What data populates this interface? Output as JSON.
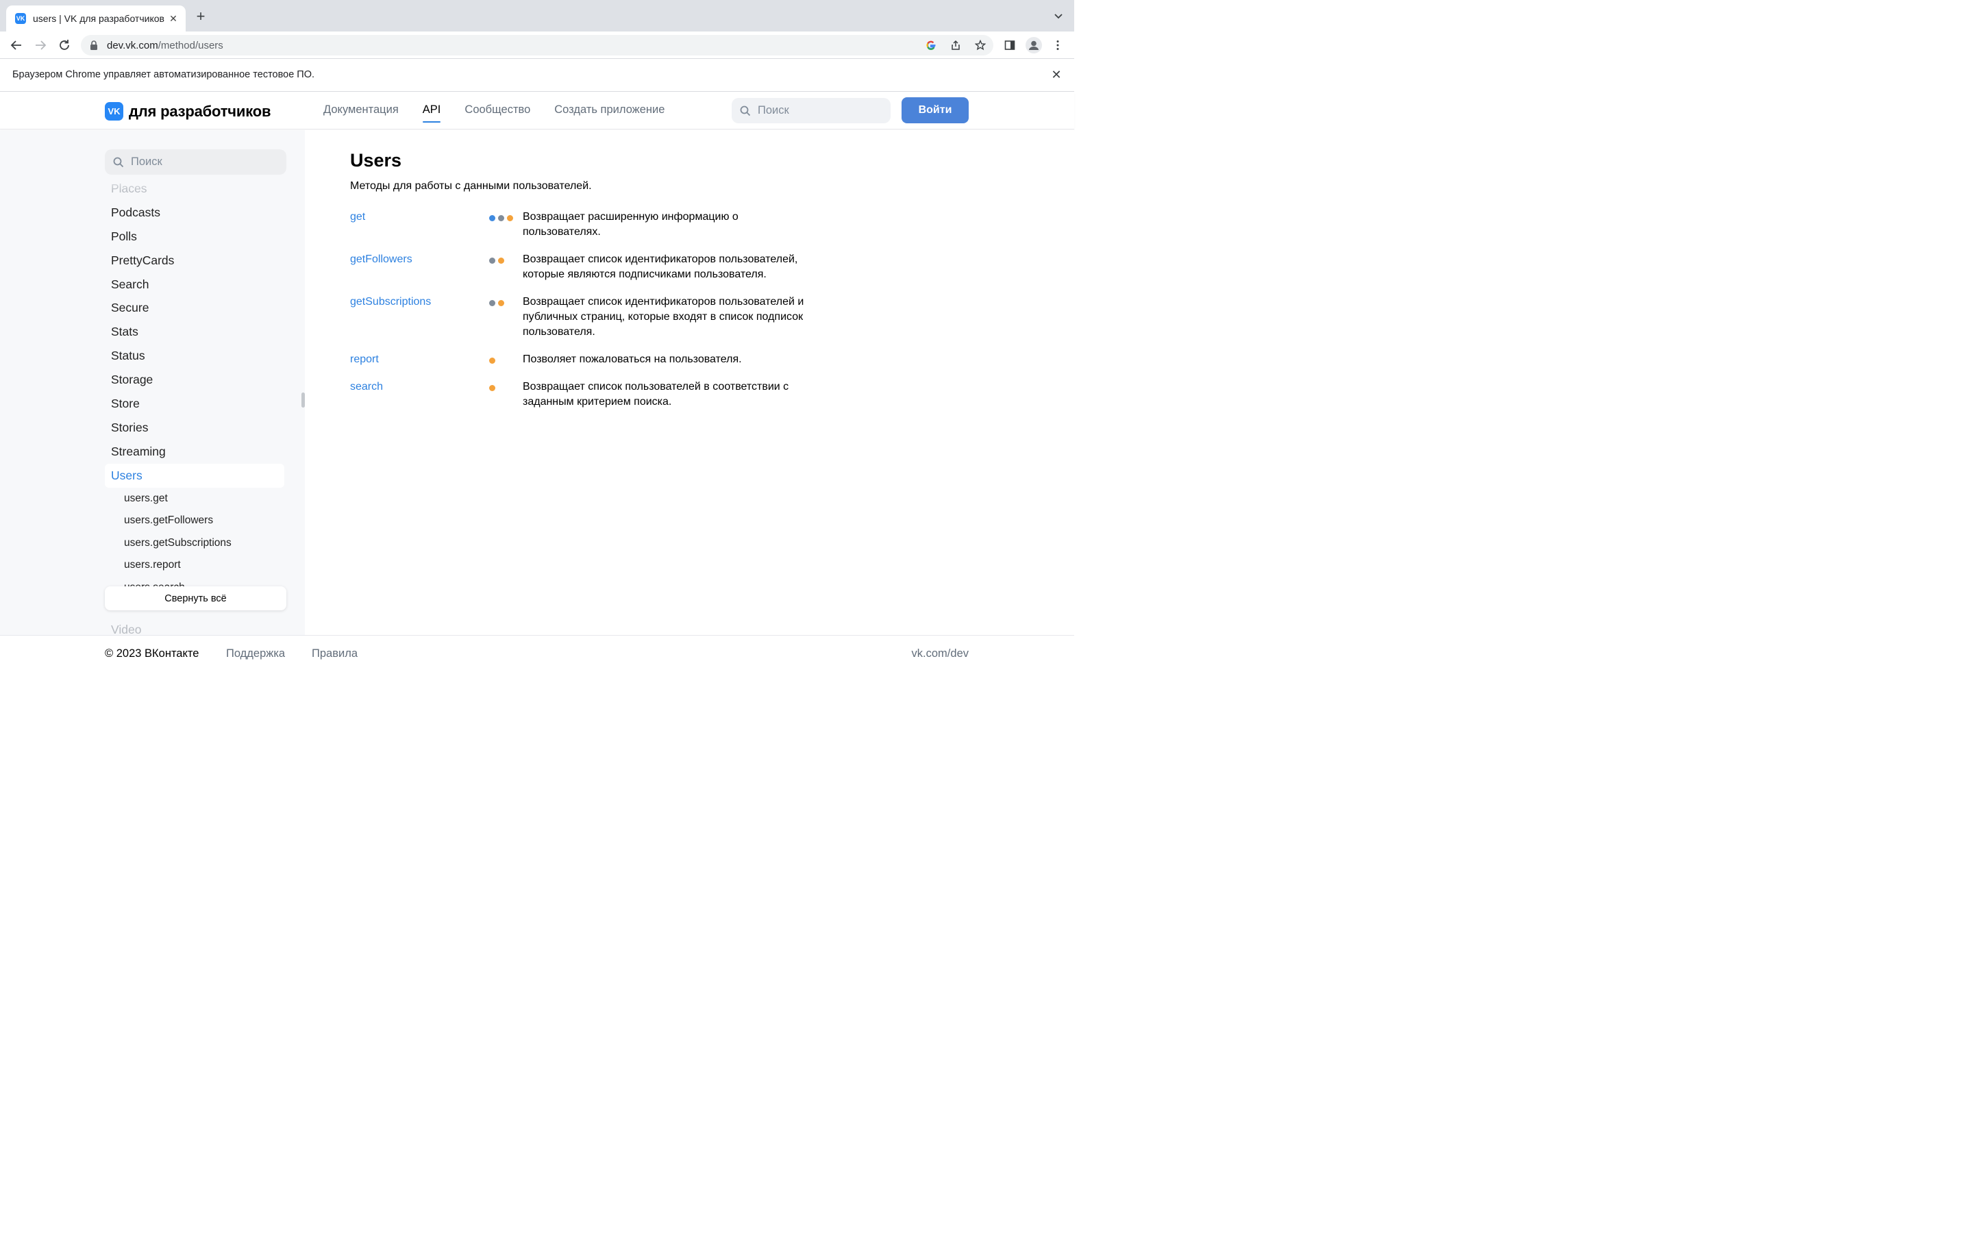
{
  "browser": {
    "tab_title": "users | VK для разработчиков",
    "favicon_text": "VK",
    "url_host": "dev.vk.com",
    "url_path": "/method/users",
    "infobar_text": "Браузером Chrome управляет автоматизированное тестовое ПО."
  },
  "header": {
    "logo_mark": "VK",
    "logo_text": "для разработчиков",
    "nav": [
      {
        "label": "Документация",
        "active": false
      },
      {
        "label": "API",
        "active": true
      },
      {
        "label": "Сообщество",
        "active": false
      },
      {
        "label": "Создать приложение",
        "active": false
      }
    ],
    "search_placeholder": "Поиск",
    "login_label": "Войти"
  },
  "sidebar": {
    "search_placeholder": "Поиск",
    "items": [
      "Places",
      "Podcasts",
      "Polls",
      "PrettyCards",
      "Search",
      "Secure",
      "Stats",
      "Status",
      "Storage",
      "Store",
      "Stories",
      "Streaming",
      "Users"
    ],
    "current": "Users",
    "sub_items": [
      "users.get",
      "users.getFollowers",
      "users.getSubscriptions",
      "users.report",
      "users.search"
    ],
    "collapse_label": "Свернуть всё",
    "bottom_item": "Video"
  },
  "main": {
    "title": "Users",
    "description": "Методы для работы с данными пользователей.",
    "methods": [
      {
        "name": "get",
        "dots": [
          "#3f8ae0",
          "#818c99",
          "#f4a23b"
        ],
        "description": "Возвращает расширенную информацию о пользователях."
      },
      {
        "name": "getFollowers",
        "dots": [
          "#818c99",
          "#f4a23b"
        ],
        "description": "Возвращает список идентификаторов пользователей, которые являются подписчиками пользователя."
      },
      {
        "name": "getSubscriptions",
        "dots": [
          "#818c99",
          "#f4a23b"
        ],
        "description": "Возвращает список идентификаторов пользователей и публичных страниц, которые входят в список подписок пользователя."
      },
      {
        "name": "report",
        "dots": [
          "#f4a23b"
        ],
        "description": "Позволяет пожаловаться на пользователя."
      },
      {
        "name": "search",
        "dots": [
          "#f4a23b"
        ],
        "description": "Возвращает список пользователей в соответствии с заданным критерием поиска."
      }
    ]
  },
  "footer": {
    "copyright": "© 2023 ВКонтакте",
    "links": [
      "Поддержка",
      "Правила"
    ],
    "right_link": "vk.com/dev"
  },
  "colors": {
    "accent": "#2d81e0",
    "button": "#4b83d9",
    "sidebar_bg": "#f7f8fa"
  }
}
